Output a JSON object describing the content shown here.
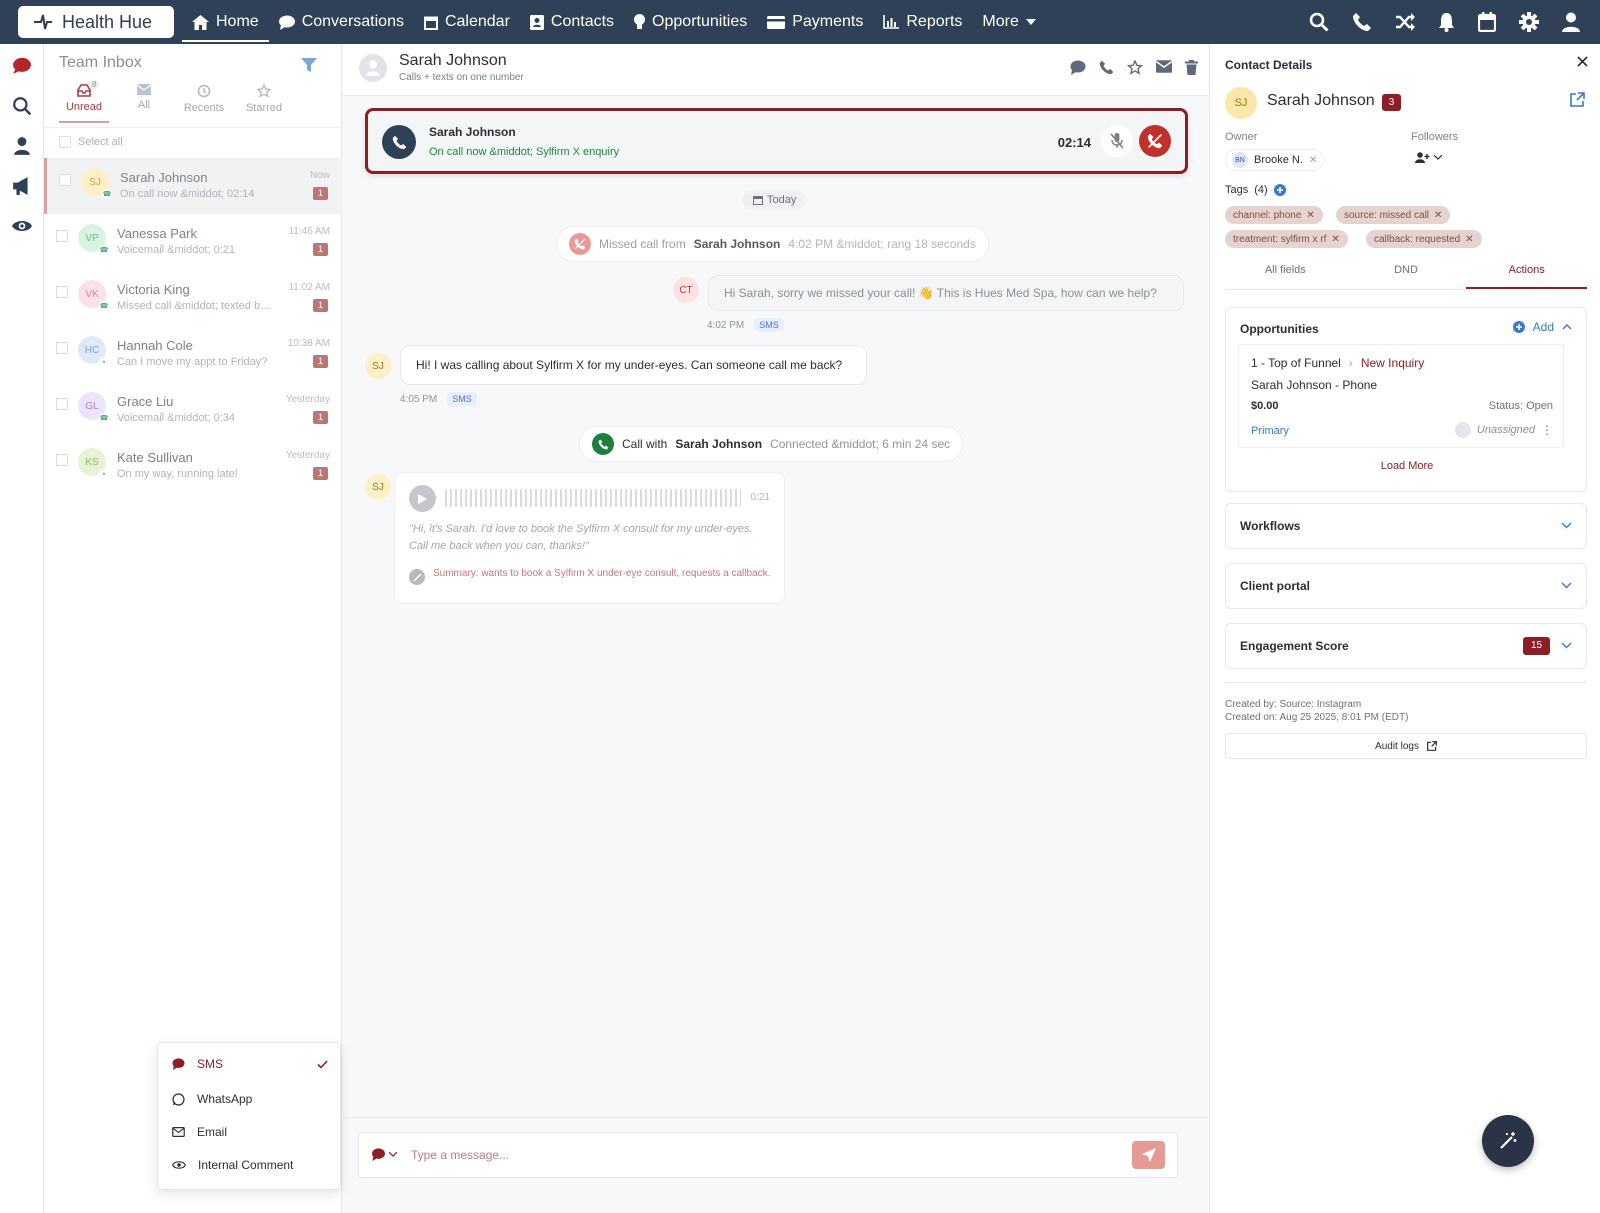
{
  "brand": {
    "name": "Health Hue"
  },
  "nav": {
    "items": [
      {
        "label": "Home"
      },
      {
        "label": "Conversations"
      },
      {
        "label": "Calendar"
      },
      {
        "label": "Contacts"
      },
      {
        "label": "Opportunities"
      },
      {
        "label": "Payments"
      },
      {
        "label": "Reports"
      },
      {
        "label": "More"
      }
    ]
  },
  "inbox": {
    "title": "Team Inbox",
    "tabs": [
      {
        "label": "Unread",
        "count": "8"
      },
      {
        "label": "All"
      },
      {
        "label": "Recents"
      },
      {
        "label": "Starred"
      }
    ],
    "select_all": "Select all",
    "conversations": [
      {
        "initials": "SJ",
        "name": "Sarah Johnson",
        "preview": "On call now &middot; 02:14",
        "time": "Now",
        "unread": "1"
      },
      {
        "initials": "VP",
        "name": "Vanessa Park",
        "preview": "Voicemail &middot; 0:21",
        "time": "11:46 AM",
        "unread": "1"
      },
      {
        "initials": "VK",
        "name": "Victoria King",
        "preview": "Missed call &middot; texted back",
        "time": "11:02 AM",
        "unread": "1"
      },
      {
        "initials": "HC",
        "name": "Hannah Cole",
        "preview": "Can I move my appt to Friday?",
        "time": "10:38 AM",
        "unread": "1"
      },
      {
        "initials": "GL",
        "name": "Grace Liu",
        "preview": "Voicemail &middot; 0:34",
        "time": "Yesterday",
        "unread": "1"
      },
      {
        "initials": "KS",
        "name": "Kate Sullivan",
        "preview": "On my way, running late!",
        "time": "Yesterday",
        "unread": "1"
      }
    ]
  },
  "chat": {
    "contact_name": "Sarah Johnson",
    "contact_sub": "Calls + texts on one number",
    "active_call": {
      "name": "Sarah Johnson",
      "status": "On call now &middot; Sylfirm X enquiry",
      "timer": "02:14"
    },
    "date_pill": "Today",
    "missed_call": {
      "prefix": "Missed call from",
      "name": "Sarah Johnson",
      "detail": "4:02 PM &middot; rang 18 seconds"
    },
    "outgoing": {
      "initials": "CT",
      "text": "Hi Sarah, sorry we missed your call! 👋 This is Hues Med Spa, how can we help?",
      "time": "4:02 PM",
      "channel": "SMS"
    },
    "incoming": {
      "initials": "SJ",
      "text": "Hi! I was calling about Sylfirm X for my under-eyes. Can someone call me back?",
      "time": "4:05 PM",
      "channel": "SMS"
    },
    "call_log": {
      "prefix": "Call with",
      "name": "Sarah Johnson",
      "detail": "Connected &middot; 6 min 24 sec"
    },
    "voicemail": {
      "initials": "SJ",
      "duration": "0:21",
      "quote": "\"Hi, it's Sarah. I'd love to book the Sylfirm X consult for my under-eyes. Call me back when you can, thanks!\"",
      "summary": "Summary: wants to book a Sylfirm X under-eye consult, requests a callback."
    },
    "composer": {
      "placeholder": "Type a message..."
    },
    "channel_menu": [
      {
        "label": "SMS",
        "selected": true
      },
      {
        "label": "WhatsApp"
      },
      {
        "label": "Email"
      },
      {
        "label": "Internal Comment"
      }
    ]
  },
  "details": {
    "title": "Contact Details",
    "initials": "SJ",
    "name": "Sarah Johnson",
    "badge": "3",
    "owner_label": "Owner",
    "owner": {
      "initials": "BN",
      "name": "Brooke N."
    },
    "followers_label": "Followers",
    "tags_label": "Tags",
    "tags_count": "(4)",
    "tags": [
      "channel: phone",
      "source: missed call",
      "treatment: sylfirm x rf",
      "callback: requested"
    ],
    "tabs": [
      "All fields",
      "DND",
      "Actions"
    ],
    "opportunities": {
      "title": "Opportunities",
      "add": "Add",
      "pipeline": "1 - Top of Funnel",
      "stage": "New Inquiry",
      "name": "Sarah Johnson - Phone",
      "value": "$0.00",
      "status": "Status: Open",
      "tag": "Primary",
      "assignee": "Unassigned",
      "load_more": "Load More"
    },
    "workflows": "Workflows",
    "client_portal": "Client portal",
    "engagement": {
      "label": "Engagement Score",
      "score": "15"
    },
    "created_by": "Created by: Source: Instagram",
    "created_on": "Created on: Aug 25 2025, 8:01 PM (EDT)",
    "audit_logs": "Audit logs"
  },
  "colors": {
    "nav": "#2e4156",
    "accent": "#8e1e26",
    "danger": "#c0312b",
    "success": "#1a8a3a"
  }
}
